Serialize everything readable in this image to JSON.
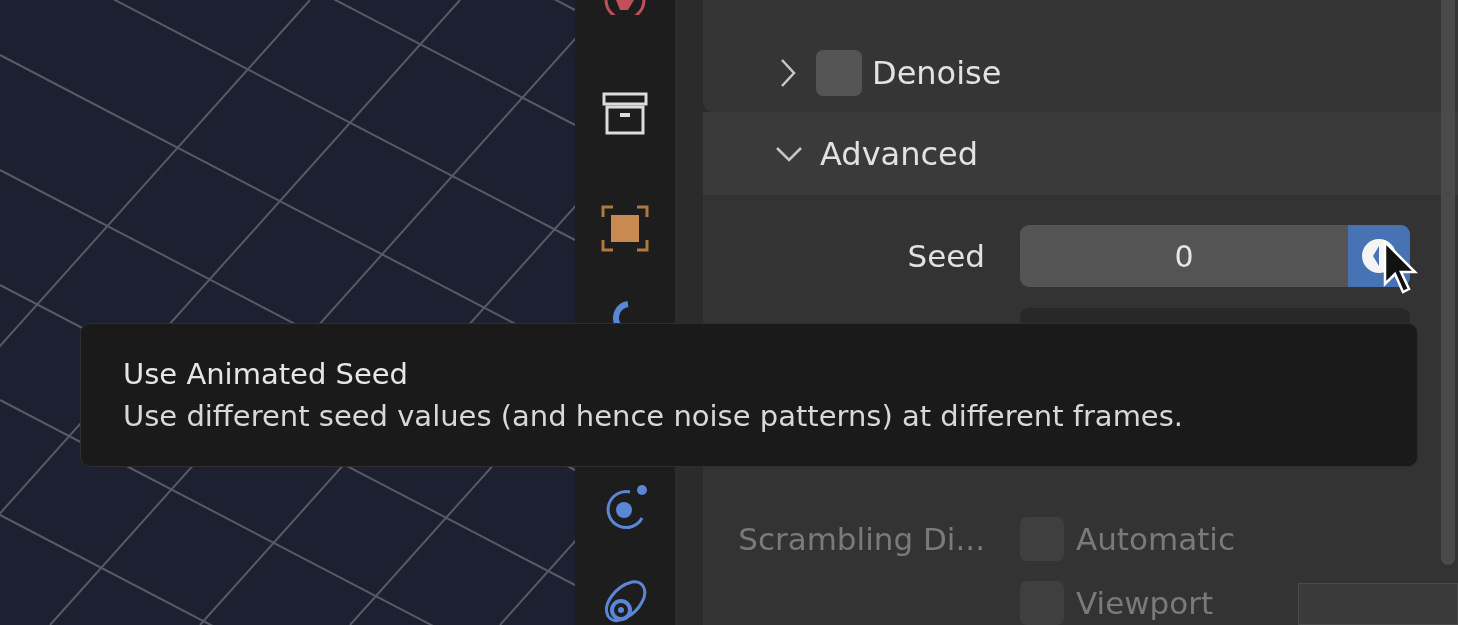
{
  "panels": [
    {
      "kind": "subpanel",
      "label": "Denoise",
      "expanded": false,
      "checked": false
    },
    {
      "kind": "section",
      "label": "Advanced",
      "expanded": true
    }
  ],
  "seed": {
    "label": "Seed",
    "value": "0",
    "animated": true
  },
  "scrambling": {
    "label": "Scrambling Di...",
    "disabled": true,
    "options": [
      {
        "label": "Automatic",
        "checked": false
      },
      {
        "label": "Viewport",
        "checked": false
      }
    ]
  },
  "tooltip": {
    "title": "Use Animated Seed",
    "description": "Use different seed values (and hence noise patterns) at different frames."
  }
}
